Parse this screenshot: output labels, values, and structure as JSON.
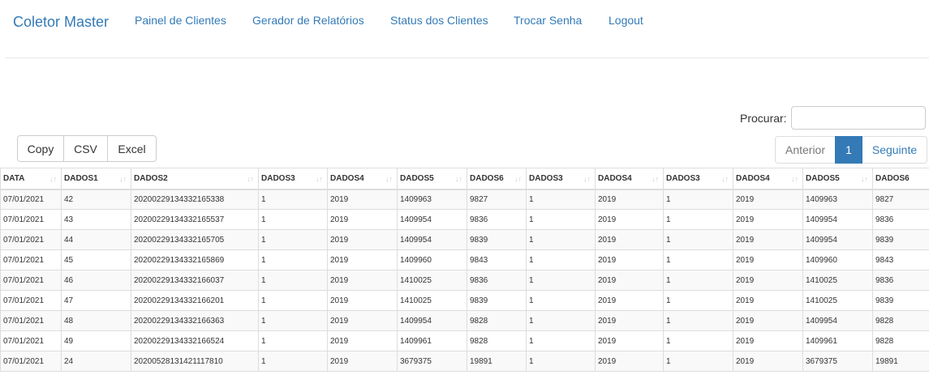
{
  "nav": {
    "brand": "Coletor Master",
    "links": [
      "Painel de Clientes",
      "Gerador de Relatórios",
      "Status dos Clientes",
      "Trocar Senha",
      "Logout"
    ]
  },
  "search": {
    "label": "Procurar:",
    "value": ""
  },
  "buttons": {
    "copy": "Copy",
    "csv": "CSV",
    "excel": "Excel"
  },
  "pagination": {
    "prev": "Anterior",
    "current": "1",
    "next": "Seguinte"
  },
  "table": {
    "columns": [
      "DATA",
      "DADOS1",
      "DADOS2",
      "DADOS3",
      "DADOS4",
      "DADOS5",
      "DADOS6",
      "DADOS3",
      "DADOS4",
      "DADOS3",
      "DADOS4",
      "DADOS5",
      "DADOS6"
    ],
    "rows": [
      [
        "07/01/2021",
        "42",
        "20200229134332165338",
        "1",
        "2019",
        "1409963",
        "9827",
        "1",
        "2019",
        "1",
        "2019",
        "1409963",
        "9827"
      ],
      [
        "07/01/2021",
        "43",
        "20200229134332165537",
        "1",
        "2019",
        "1409954",
        "9836",
        "1",
        "2019",
        "1",
        "2019",
        "1409954",
        "9836"
      ],
      [
        "07/01/2021",
        "44",
        "20200229134332165705",
        "1",
        "2019",
        "1409954",
        "9839",
        "1",
        "2019",
        "1",
        "2019",
        "1409954",
        "9839"
      ],
      [
        "07/01/2021",
        "45",
        "20200229134332165869",
        "1",
        "2019",
        "1409960",
        "9843",
        "1",
        "2019",
        "1",
        "2019",
        "1409960",
        "9843"
      ],
      [
        "07/01/2021",
        "46",
        "20200229134332166037",
        "1",
        "2019",
        "1410025",
        "9836",
        "1",
        "2019",
        "1",
        "2019",
        "1410025",
        "9836"
      ],
      [
        "07/01/2021",
        "47",
        "20200229134332166201",
        "1",
        "2019",
        "1410025",
        "9839",
        "1",
        "2019",
        "1",
        "2019",
        "1410025",
        "9839"
      ],
      [
        "07/01/2021",
        "48",
        "20200229134332166363",
        "1",
        "2019",
        "1409954",
        "9828",
        "1",
        "2019",
        "1",
        "2019",
        "1409954",
        "9828"
      ],
      [
        "07/01/2021",
        "49",
        "20200229134332166524",
        "1",
        "2019",
        "1409961",
        "9828",
        "1",
        "2019",
        "1",
        "2019",
        "1409961",
        "9828"
      ],
      [
        "07/01/2021",
        "24",
        "20200528131421117810",
        "1",
        "2019",
        "3679375",
        "19891",
        "1",
        "2019",
        "1",
        "2019",
        "3679375",
        "19891"
      ]
    ]
  }
}
